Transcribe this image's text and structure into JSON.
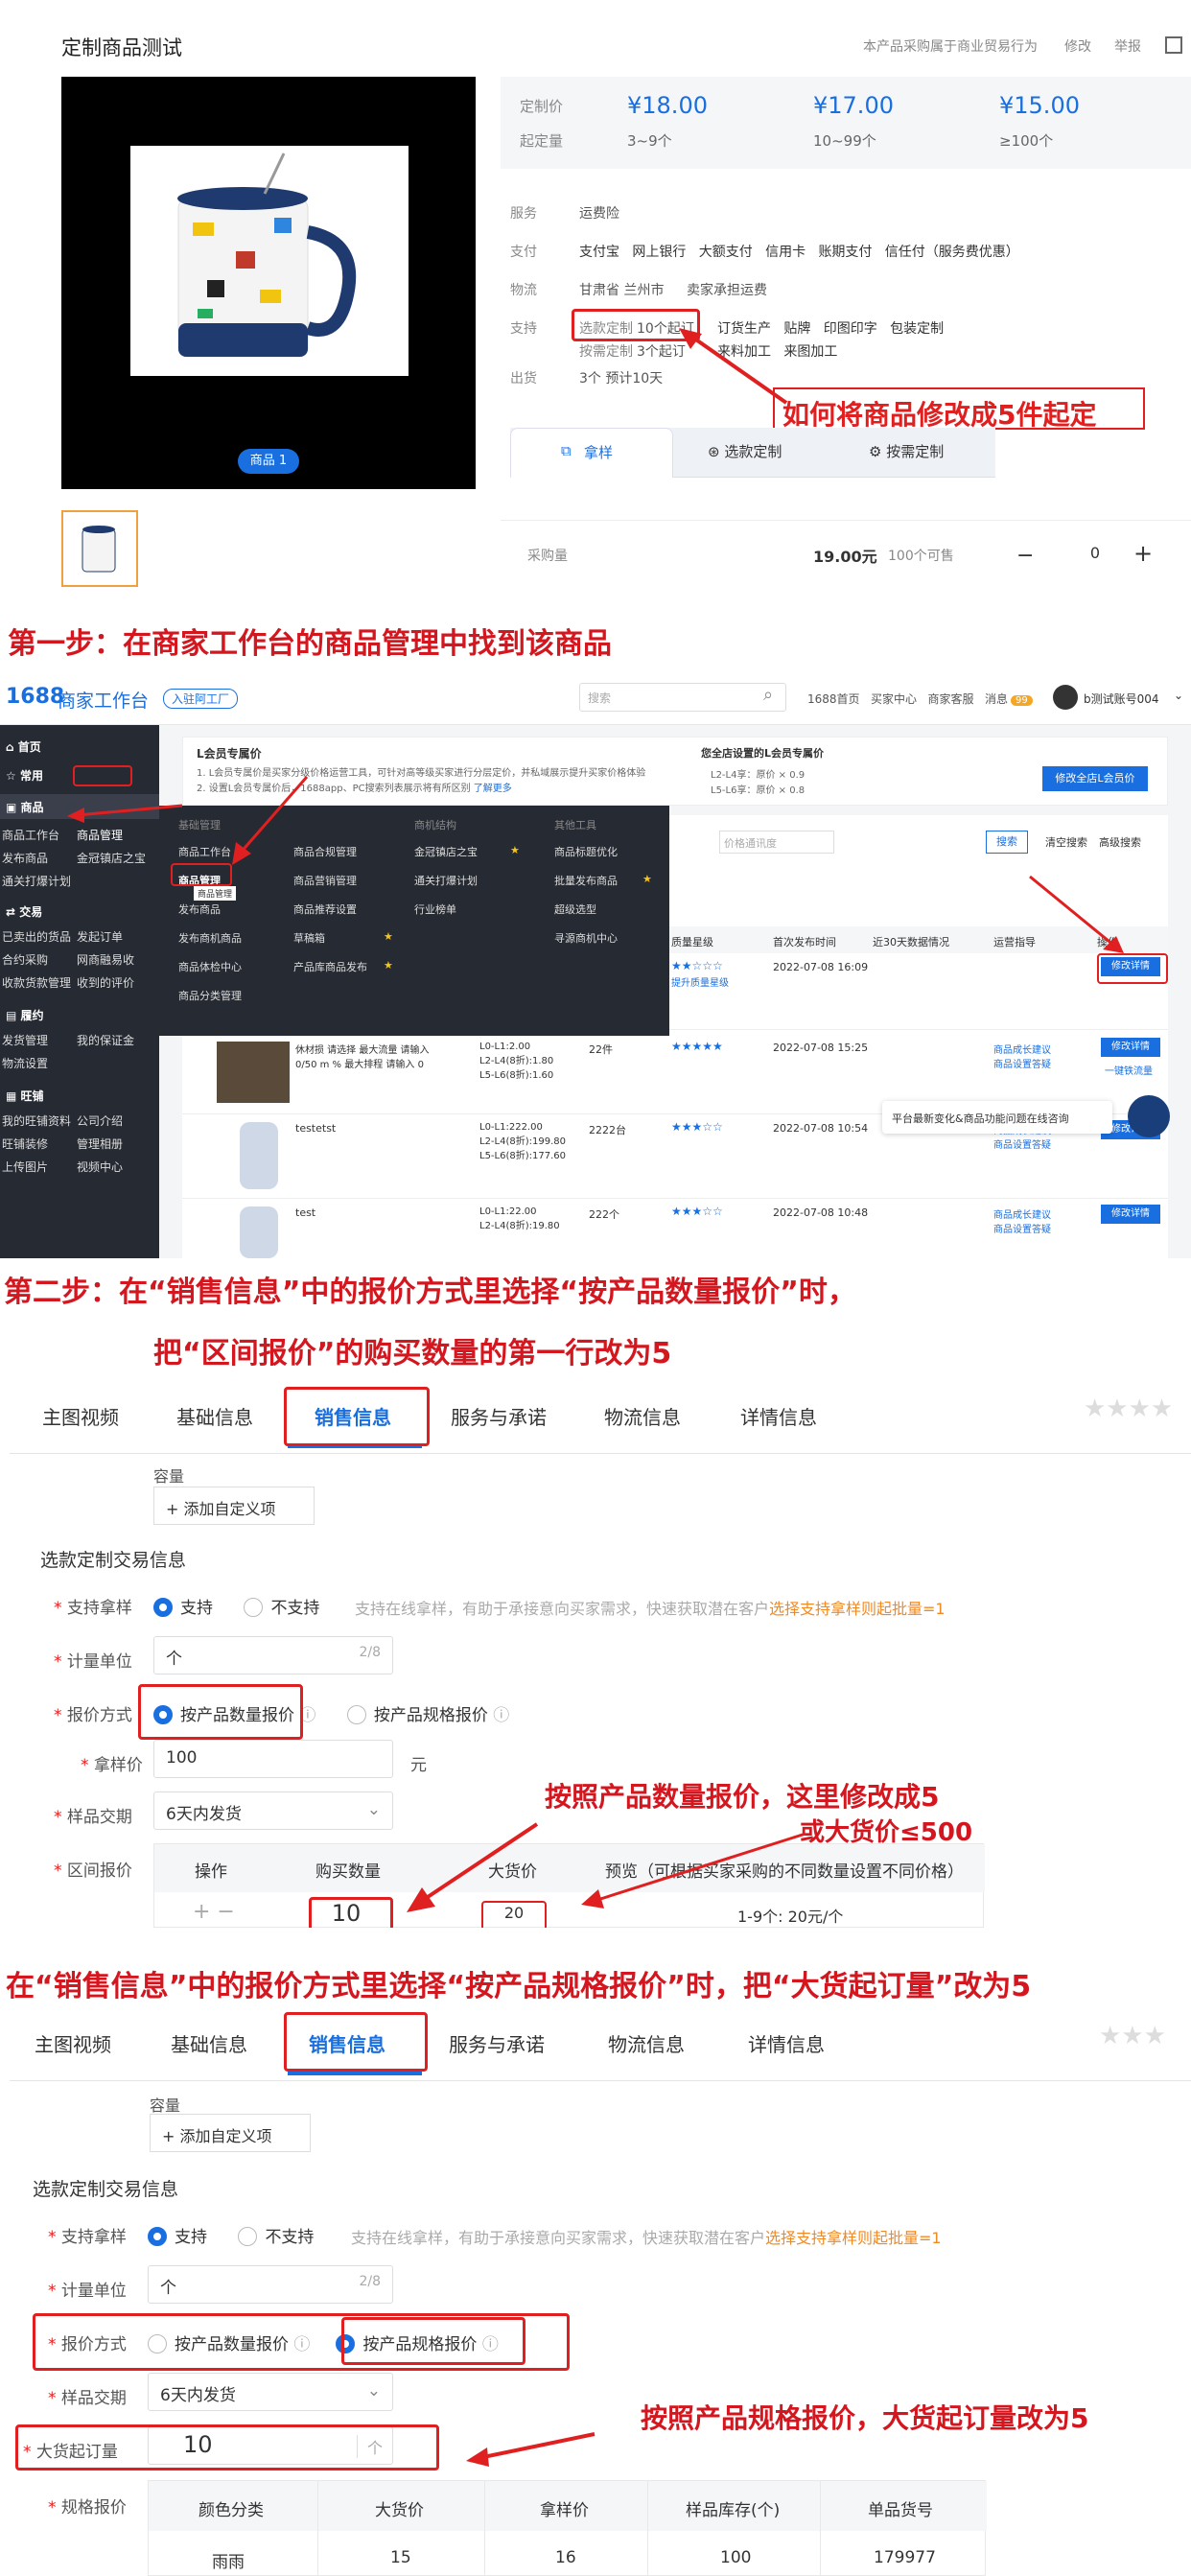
{
  "product": {
    "title": "定制商品测试",
    "notice": "本产品采购属于商业贸易行为",
    "edit": "修改",
    "report": "举报",
    "badge": "商品 1",
    "price_label": "定制价",
    "moq_label": "起定量",
    "tiers": [
      {
        "price": "¥18.00",
        "range": "3~9个"
      },
      {
        "price": "¥17.00",
        "range": "10~99个"
      },
      {
        "price": "¥15.00",
        "range": "≥100个"
      }
    ],
    "service_label": "服务",
    "service": "运费险",
    "pay_label": "支付",
    "pay": [
      "支付宝",
      "网上银行",
      "大额支付",
      "信用卡",
      "账期支付",
      "信任付（服务费优惠）"
    ],
    "logi_label": "物流",
    "logi": "甘肃省 兰州市",
    "logi2": "卖家承担运费",
    "support_label": "支持",
    "custom_select": "选款定制",
    "custom_select_moq": "10个起订",
    "support_items": [
      "订货生产",
      "贴牌",
      "印图印字",
      "包装定制"
    ],
    "custom_demand": "按需定制",
    "custom_demand_moq": "3个起订",
    "support_items2": [
      "来料加工",
      "来图加工"
    ],
    "ship_label": "出货",
    "ship": "3个 预计10天",
    "tabs": [
      "拿样",
      "选款定制",
      "按需定制"
    ],
    "qty_label": "采购量",
    "total": "19.00元",
    "stock": "100个可售",
    "qty": "0",
    "minus": "−",
    "plus": "+"
  },
  "callouts": {
    "q": "如何将商品修改成5件起定",
    "step1": "第一步：在商家工作台的商品管理中找到该商品",
    "step2a": "第二步：在“销售信息”中的报价方式里选择“按产品数量报价”时，",
    "step2b": "把“区间报价”的购买数量的第一行改为5",
    "note1": "按照产品数量报价，这里修改成5",
    "note1b": "或大货价≤500",
    "step3": "在“销售信息”中的报价方式里选择“按产品规格报价”时，把“大货起订量”改为5",
    "note2": "按照产品规格报价，大货起订量改为5"
  },
  "workbench": {
    "logo": "1688",
    "logo2": "商家工作台",
    "tag": "入驻阿工厂",
    "search_ph": "搜索",
    "nav": [
      "1688首页",
      "买家中心",
      "商家客服",
      "消息"
    ],
    "msg_count": "99",
    "account": "b测试账号004",
    "side": [
      {
        "h": "首页"
      },
      {
        "h": "常用"
      },
      {
        "h": "商品",
        "items": [
          "商品工作台",
          "商品管理",
          "发布商品",
          "金冠镇店之宝",
          "通关打爆计划"
        ]
      },
      {
        "h": "交易",
        "items": [
          "已卖出的货品",
          "发起订单",
          "合约采购",
          "网商融易收",
          "收款货款管理",
          "收到的评价"
        ]
      },
      {
        "h": "履约",
        "items": [
          "发货管理",
          "我的保证金",
          "物流设置"
        ]
      },
      {
        "h": "旺铺",
        "items": [
          "我的旺铺资料",
          "公司介绍",
          "旺铺装修",
          "管理相册",
          "上传图片",
          "视频中心"
        ]
      }
    ],
    "promo_title": "L会员专属价",
    "promo_1": "1. L会员专属价是买家分级价格运营工具，可针对高等级买家进行分层定价，并私域展示提升买家价格体验",
    "promo_2": "2. 设置L会员专属价后，1688app、PC搜索列表展示将有所区别",
    "promo_more": "了解更多",
    "store_title": "您全店设置的L会员专属价",
    "store_1": "L2-L4享：原价 × 0.9",
    "store_2": "L5-L6享：原价 × 0.8",
    "store_btn": "修改全店L会员价",
    "menu_cols": [
      {
        "h": "基础管理",
        "items": [
          "商品工作台",
          "商品管理",
          "发布商品",
          "发布商机商品",
          "商品体检中心",
          "商品分类管理"
        ]
      },
      {
        "h": "",
        "items": [
          "商品合规管理",
          "商品营销管理",
          "商品推荐设置",
          "草稿箱",
          "产品库商品发布",
          ""
        ]
      },
      {
        "h": "商机结构",
        "items": [
          "金冠镇店之宝",
          "通关打爆计划",
          "行业榜单"
        ]
      },
      {
        "h": "其他工具",
        "items": [
          "商品标题优化",
          "批量发布商品",
          "超级选型",
          "寻源商机中心"
        ]
      }
    ],
    "tooltip": "商品管理",
    "filter": "价格通讯度",
    "search_btn": "搜索",
    "clear": "清空搜索",
    "adv": "高级搜索",
    "cols": [
      "质量星级",
      "首次发布时间",
      "近30天数据情况",
      "运营指导",
      "操作"
    ],
    "rows": [
      {
        "name": "",
        "price": "",
        "stock": "",
        "time": "2022-07-08 16:09",
        "guide": "",
        "link": "提升质量星级"
      },
      {
        "name": "休材损 请选择 最大流量 请输入 0/50 m % 最大排程 请输入 0",
        "price": "L0-L1:2.00\nL2-L4(8折):1.80\nL5-L6(8折):1.60",
        "stock": "22件",
        "time": "2022-07-08 15:25",
        "guide": "商品成长建议\n商品设置答疑",
        "link": "一键铁流量"
      },
      {
        "name": "testetst",
        "price": "L0-L1:222.00\nL2-L4(8折):199.80\nL5-L6(8折):177.60",
        "stock": "2222台",
        "time": "2022-07-08 10:54",
        "guide": "商品成长建议\n商品设置答疑",
        "link": ""
      },
      {
        "name": "test",
        "price": "L0-L1:22.00\nL2-L4(8折):19.80",
        "stock": "222个",
        "time": "2022-07-08 10:48",
        "guide": "商品成长建议\n商品设置答疑",
        "link": ""
      }
    ],
    "edit_btn": "修改详情",
    "chat": "平台最新变化&商品功能问题在线咨询"
  },
  "form": {
    "tabs": [
      "主图视频",
      "基础信息",
      "销售信息",
      "服务与承诺",
      "物流信息",
      "详情信息"
    ],
    "cap_label": "容量",
    "add_custom": "+ 添加自定义项",
    "section": "选款定制交易信息",
    "support_sample": "支持拿样",
    "yes": "支持",
    "no": "不支持",
    "sample_hint": "支持在线拿样，有助于承接意向买家需求，快速获取潜在客户",
    "sample_link": "选择支持拿样则起批量=1",
    "unit_label": "计量单位",
    "unit": "个",
    "unit_count": "2/8",
    "quote_label": "报价方式",
    "quote_qty": "按产品数量报价",
    "quote_spec": "按产品规格报价",
    "sample_price_label": "拿样价",
    "sample_price": "100",
    "yuan": "元",
    "sample_lead_label": "样品交期",
    "sample_lead": "6天内发货",
    "range_label": "区间报价",
    "range_cols": [
      "操作",
      "购买数量",
      "大货价",
      "预览（可根据买家采购的不同数量设置不同价格）"
    ],
    "range_qty": "10",
    "range_price": "20",
    "range_preview": "1-9个: 20元/个",
    "moq_label": "大货起订量",
    "moq": "10",
    "moq_unit": "个",
    "spec_label": "规格报价",
    "spec_cols": [
      "颜色分类",
      "大货价",
      "拿样价",
      "样品库存(个)",
      "单品货号"
    ],
    "spec_row": [
      "雨雨",
      "15",
      "16",
      "100",
      "179977"
    ]
  }
}
